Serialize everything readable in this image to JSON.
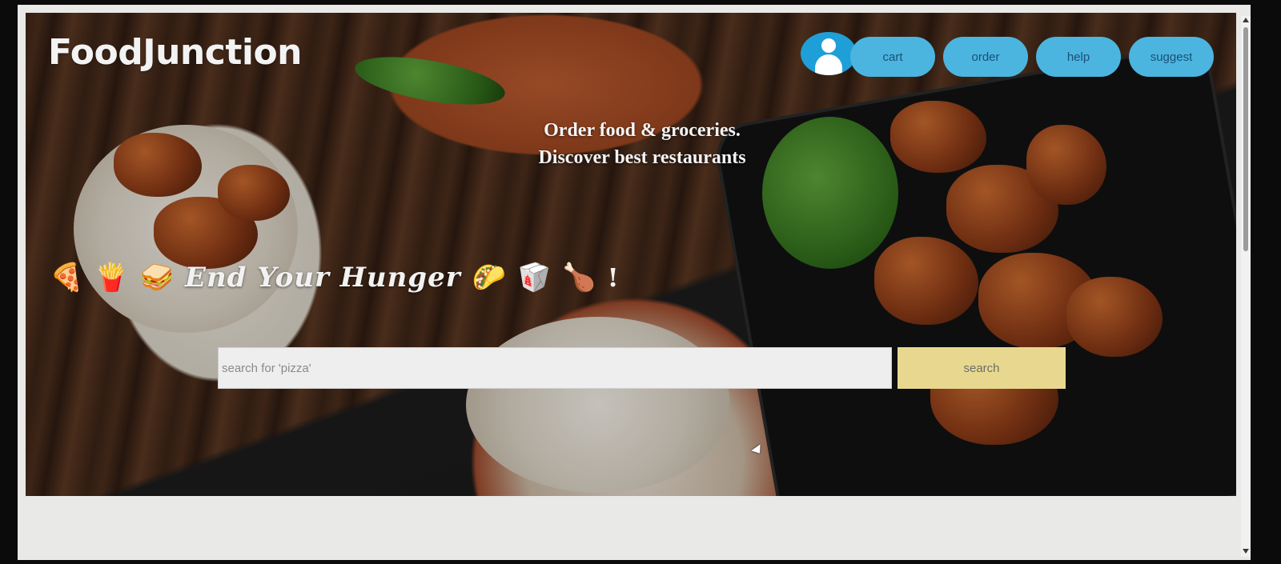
{
  "header": {
    "logo": "FoodJunction",
    "nav": [
      {
        "label": "cart"
      },
      {
        "label": "order"
      },
      {
        "label": "help"
      },
      {
        "label": "suggest"
      }
    ]
  },
  "hero": {
    "tagline_line1": "Order food & groceries.",
    "tagline_line2": "Discover best restaurants",
    "hunger_text": "End Your Hunger",
    "hunger_suffix": "!",
    "emojis_left": [
      "🍕",
      "🍟",
      "🥪"
    ],
    "emojis_right": [
      "🌮",
      "🥡",
      "🍗"
    ]
  },
  "search": {
    "placeholder": "search for 'pizza'",
    "button_label": "search"
  },
  "colors": {
    "nav_button": "#4bb5df",
    "avatar": "#1e9fd8",
    "search_button": "#e8d88f"
  }
}
